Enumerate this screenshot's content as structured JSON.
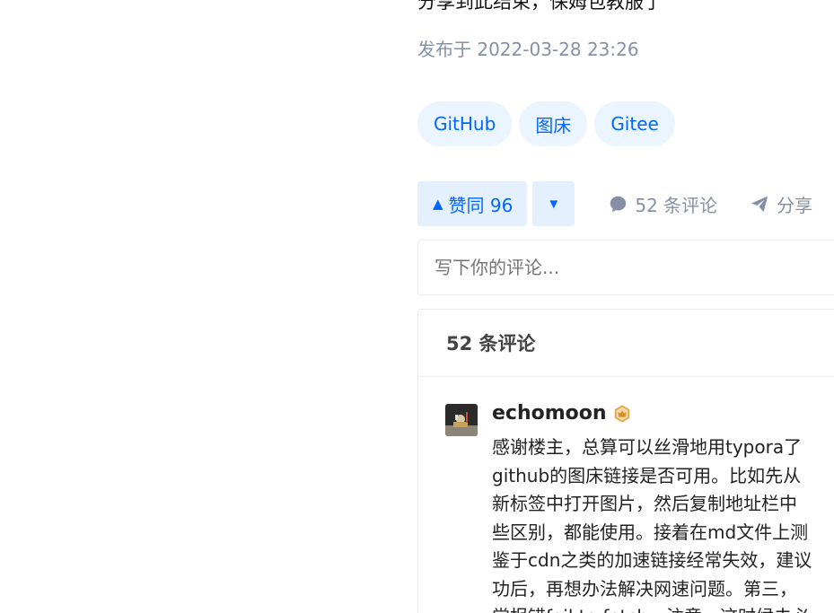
{
  "article": {
    "top_line": "分享到此结束，保姆包教服了",
    "publish_time": "发布于 2022-03-28 23:26"
  },
  "tags": [
    {
      "label": "GitHub"
    },
    {
      "label": "图床"
    },
    {
      "label": "Gitee"
    }
  ],
  "actions": {
    "vote_up_label": "赞同 96",
    "comment_count_label": "52 条评论",
    "share_label": "分享"
  },
  "comment_input": {
    "placeholder": "写下你的评论..."
  },
  "comments": {
    "header": "52 条评论",
    "items": [
      {
        "author": "echomoon",
        "lines": [
          "感谢楼主，总算可以丝滑地用typora了",
          "github的图床链接是否可用。比如先从",
          "新标签中打开图片，然后复制地址栏中",
          "些区别，都能使用。接着在md文件上测",
          "鉴于cdn之类的加速链接经常失效，建议",
          "功后，再想办法解决网速问题。第三，",
          "常报错fail to fetch。注意，这时候未必"
        ]
      }
    ]
  },
  "colors": {
    "accent": "#0066ff",
    "accent_bg": "#e5f0ff",
    "tag_bg": "#ebf5ff",
    "muted": "#8590a6",
    "badge_gold": "#e0a84e"
  }
}
